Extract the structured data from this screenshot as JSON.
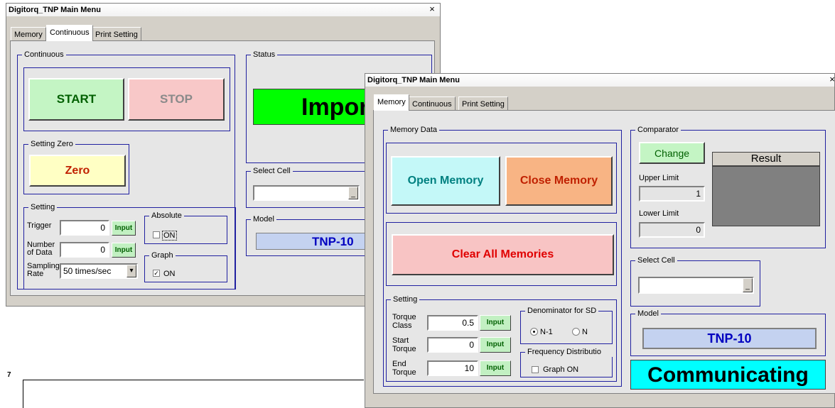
{
  "back_window": {
    "title": "Digitorq_TNP Main Menu",
    "close": "×",
    "tabs": [
      "Memory",
      "Continuous",
      "Print Setting"
    ],
    "continuous": {
      "label": "Continuous",
      "start": "START",
      "stop": "STOP",
      "setting_zero_label": "Setting Zero",
      "zero": "Zero"
    },
    "setting": {
      "label": "Setting",
      "trigger_label": "Trigger",
      "trigger_value": "0",
      "number_label": "Number of Data",
      "number_value": "0",
      "input_label": "Input",
      "sampling_label": "Sampling Rate",
      "sampling_value": "50 times/sec",
      "absolute_label": "Absolute",
      "absolute_on": "ON",
      "graph_label": "Graph",
      "graph_on": "ON"
    },
    "status": {
      "label": "Status",
      "value": "Impor"
    },
    "select_cell": {
      "label": "Select Cell",
      "value": ""
    },
    "model": {
      "label": "Model",
      "value": "TNP-10"
    }
  },
  "front_window": {
    "title": "Digitorq_TNP  Main Menu",
    "close": "×",
    "tabs": [
      "Memory",
      "Continuous",
      "Print Setting"
    ],
    "memory_data": {
      "label": "Memory Data",
      "open": "Open Memory",
      "close": "Close Memory",
      "clear": "Clear All Memories"
    },
    "setting": {
      "label": "Setting",
      "torque_class_label": "Torque Class",
      "torque_class_value": "0.5",
      "start_torque_label": "Start Torque",
      "start_torque_value": "0",
      "end_torque_label": "End Torque",
      "end_torque_value": "10",
      "input_label": "Input",
      "denominator_label": "Denominator for SD",
      "n1": "N-1",
      "n": "N",
      "freq_label": "Frequency Distributio",
      "graph_on": "Graph ON"
    },
    "comparator": {
      "label": "Comparator",
      "change": "Change",
      "result": "Result",
      "upper_label": "Upper Limit",
      "upper_value": "1",
      "lower_label": "Lower Limit",
      "lower_value": "0"
    },
    "select_cell": {
      "label": "Select Cell",
      "value": ""
    },
    "model": {
      "label": "Model",
      "value": "TNP-10"
    },
    "status": "Communicating"
  },
  "bottom_fragment": {
    "mark": "7"
  },
  "colors": {
    "start_btn": "#c4f5c4",
    "stop_btn": "#f8c8c8",
    "zero_btn": "#ffffc4",
    "status_green": "#00ff00",
    "model_blue": "#c4d2f0",
    "model_text": "#0000c0",
    "open_btn": "#c4f8f8",
    "close_btn": "#f8b484",
    "clear_btn": "#f8c4c4",
    "result_box": "#808080",
    "communicating": "#00ffff"
  }
}
